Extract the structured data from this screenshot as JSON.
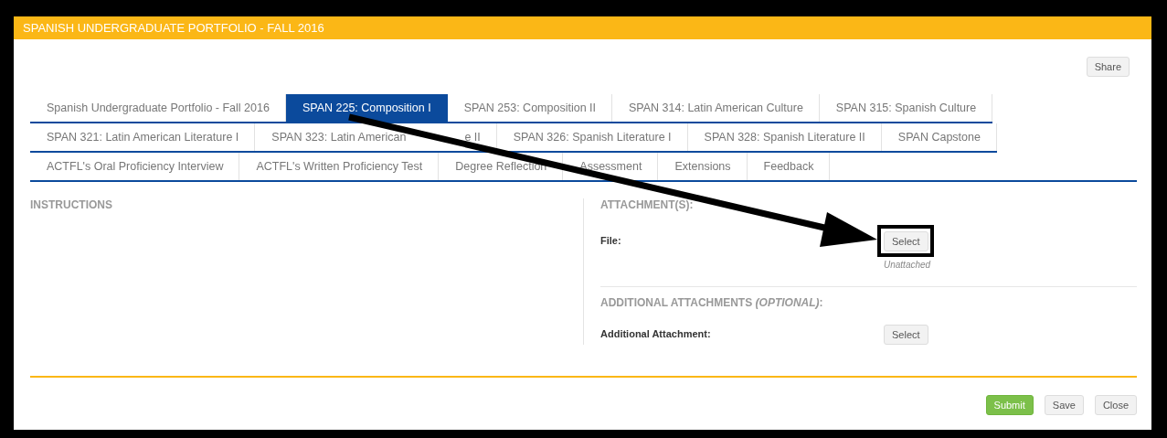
{
  "window": {
    "title": "SPANISH UNDERGRADUATE PORTFOLIO - FALL 2016"
  },
  "share_button": "Share",
  "tab_rows": [
    [
      {
        "label": "Spanish Undergraduate Portfolio - Fall 2016",
        "selected": false
      },
      {
        "label": "SPAN 225: Composition I",
        "selected": true
      },
      {
        "label": "SPAN 253: Composition II",
        "selected": false
      },
      {
        "label": "SPAN 314: Latin American Culture",
        "selected": false
      },
      {
        "label": "SPAN 315: Spanish Culture",
        "selected": false
      }
    ],
    [
      {
        "label": "SPAN 321: Latin American Literature I",
        "selected": false
      },
      {
        "label": "SPAN 323: Latin American",
        "label_tail": "e II",
        "selected": false
      },
      {
        "label": "SPAN 326: Spanish Literature I",
        "selected": false
      },
      {
        "label": "SPAN 328: Spanish Literature II",
        "selected": false
      },
      {
        "label": "SPAN Capstone",
        "selected": false
      }
    ],
    [
      {
        "label": "ACTFL's Oral Proficiency Interview",
        "selected": false
      },
      {
        "label": "ACTFL's Written Proficiency Test",
        "selected": false
      },
      {
        "label": "Degree Reflection",
        "selected": false
      },
      {
        "label": "Assessment",
        "selected": false
      },
      {
        "label": "Extensions",
        "selected": false
      },
      {
        "label": "Feedback",
        "selected": false
      }
    ]
  ],
  "instructions": {
    "heading": "INSTRUCTIONS"
  },
  "attachments": {
    "heading": "ATTACHMENT(S):",
    "field_label": "File:",
    "button": "Select",
    "status": "Unattached"
  },
  "additional": {
    "heading": "ADDITIONAL ATTACHMENTS *(OPTIONAL)*:",
    "field_label": "Additional Attachment:",
    "button": "Select"
  },
  "footer_buttons": [
    {
      "label": "Submit",
      "kind": "primary"
    },
    {
      "label": "Save",
      "kind": "default"
    },
    {
      "label": "Close",
      "kind": "default"
    }
  ]
}
